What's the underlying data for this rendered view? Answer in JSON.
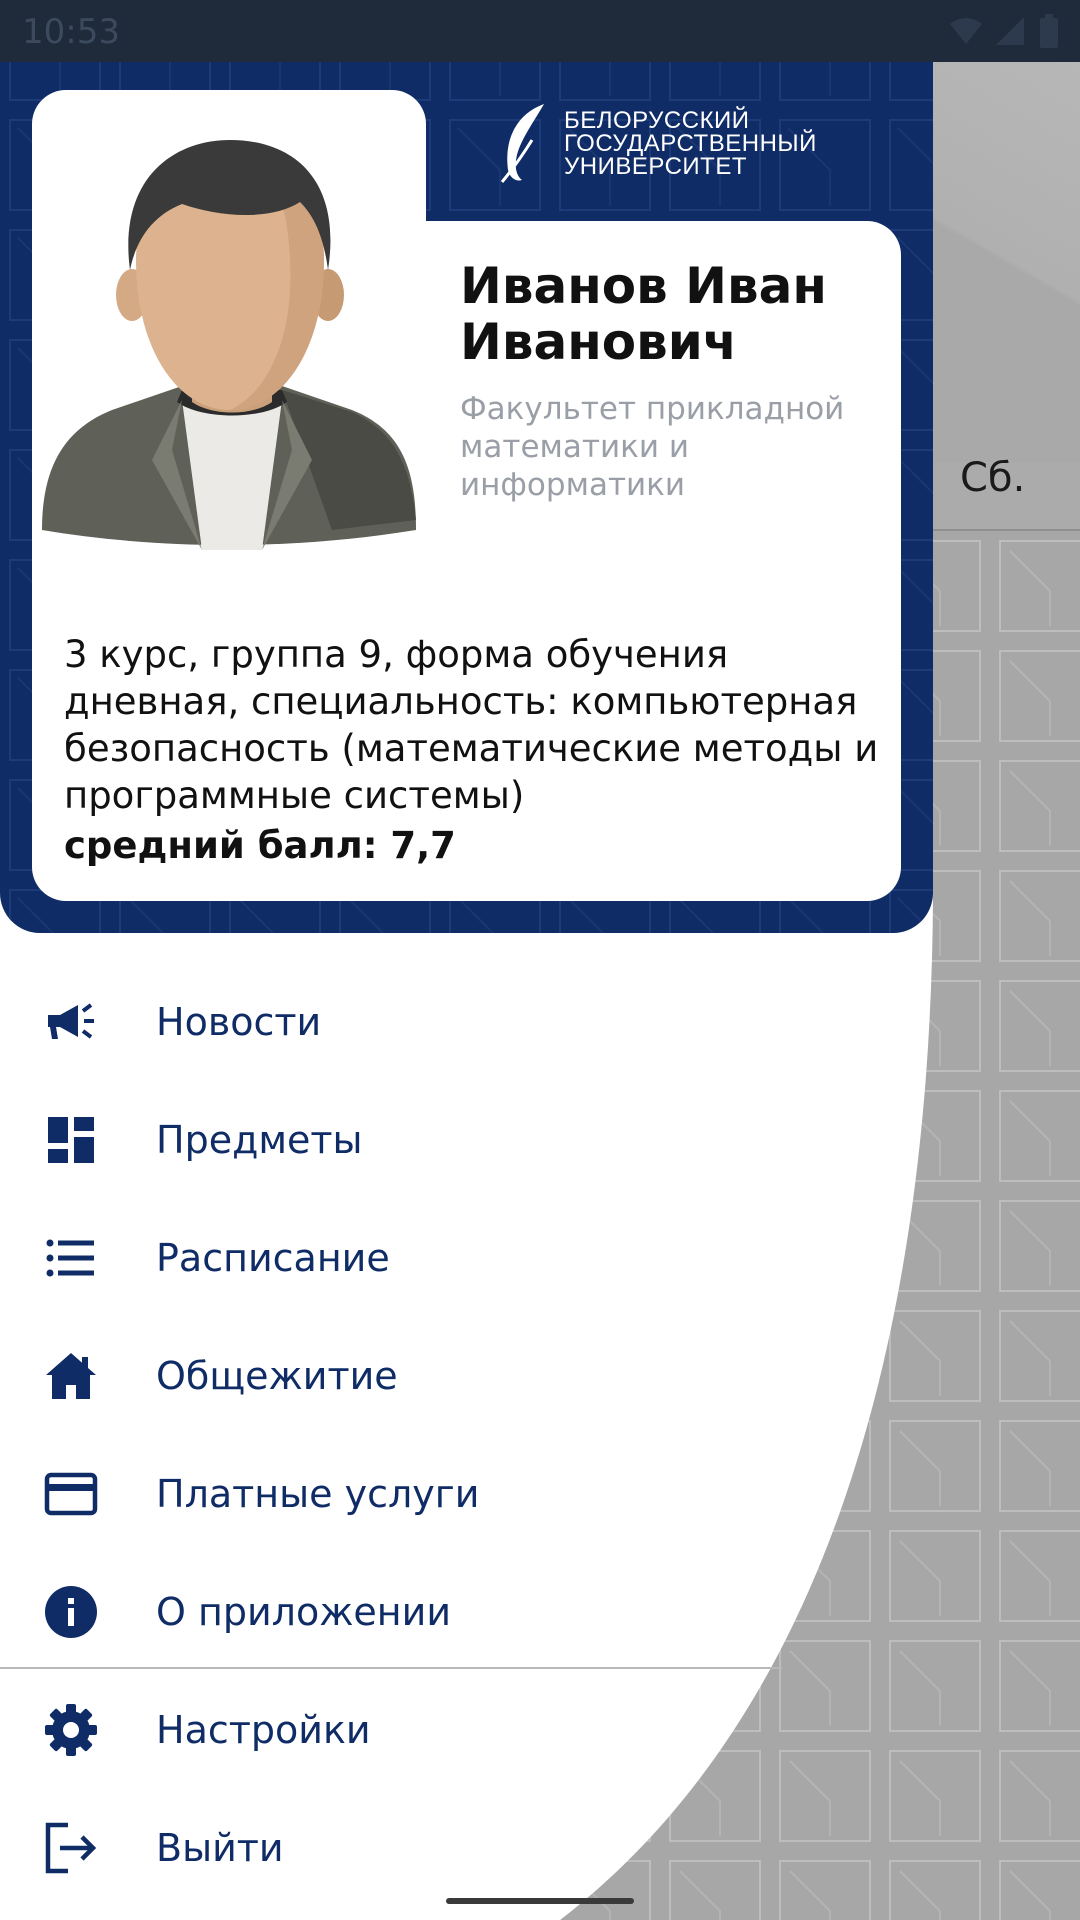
{
  "status_bar": {
    "time": "10:53"
  },
  "background": {
    "day_label": "Сб."
  },
  "header": {
    "logo_lines": [
      "БЕЛОРУССКИЙ",
      "ГОСУДАРСТВЕННЫЙ",
      "УНИВЕРСИТЕТ"
    ]
  },
  "student": {
    "name": "Иванов Иван Иванович",
    "faculty": "Факультет прикладной математики и информатики",
    "details": "3 курс, группа 9, форма обучения дневная, специальность: компьютерная безопасность (математические методы и программные системы)",
    "gpa": "средний балл: 7,7"
  },
  "menu": {
    "items": [
      {
        "label": "Новости",
        "icon": "megaphone-icon"
      },
      {
        "label": "Предметы",
        "icon": "dashboard-icon"
      },
      {
        "label": "Расписание",
        "icon": "list-icon"
      },
      {
        "label": "Общежитие",
        "icon": "home-icon"
      },
      {
        "label": "Платные услуги",
        "icon": "credit-card-icon"
      },
      {
        "label": "О приложении",
        "icon": "info-icon"
      }
    ],
    "footer_items": [
      {
        "label": "Настройки",
        "icon": "gear-icon"
      },
      {
        "label": "Выйти",
        "icon": "logout-icon"
      }
    ]
  },
  "colors": {
    "primary": "#0f2c66",
    "card": "#ffffff",
    "secondary_text": "#9a9fa7"
  }
}
